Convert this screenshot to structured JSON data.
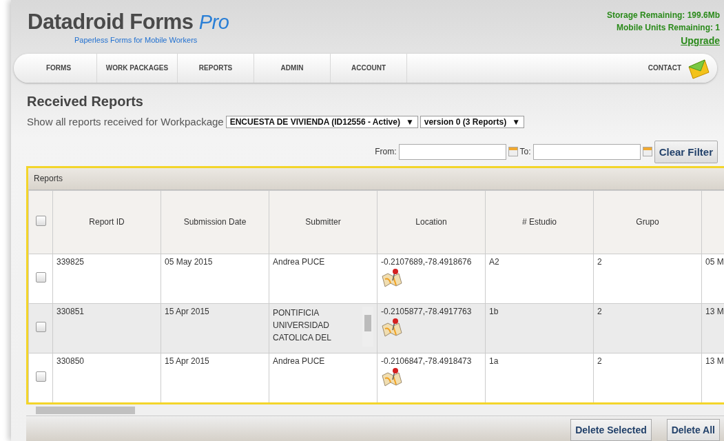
{
  "header": {
    "logo": "Datadroid Forms",
    "logo_suffix": "Pro",
    "tagline": "Paperless Forms for Mobile Workers",
    "storage": "Storage Remaining: 199.6Mb",
    "units": "Mobile Units Remaining: 1",
    "upgrade_link": "Upgrade"
  },
  "nav": {
    "items": [
      "FORMS",
      "WORK PACKAGES",
      "REPORTS",
      "ADMIN",
      "ACCOUNT"
    ],
    "contact": "CONTACT"
  },
  "page": {
    "title": "Received Reports",
    "filter_label": "Show all reports received for Workpackage",
    "workpackage": "ENCUESTA DE VIVIENDA (ID12556 - Active)",
    "workpackage_arrow": "▼",
    "version": "version 0 (3 Reports)",
    "version_arrow": "▼"
  },
  "date_filter": {
    "from_label": "From:",
    "to_label": "To:",
    "clear_button": "Clear Filter"
  },
  "reports": {
    "caption": "Reports",
    "select_all_checked": false,
    "columns": [
      "Report ID",
      "Submission Date",
      "Submitter",
      "Location",
      "# Estudio",
      "Grupo"
    ],
    "rows": [
      {
        "checked": false,
        "selected": false,
        "kind": "plain",
        "cells": [
          "339825",
          "05 May 2015",
          "Andrea PUCE",
          "-0.2107689,-78.4918676",
          "A2",
          "2",
          "05 M"
        ]
      },
      {
        "checked": false,
        "selected": true,
        "kind": "scrolling",
        "cells": [
          "330851",
          "15 Apr 2015",
          "PONTIFICIA UNIVERSIDAD CATOLICA DEL",
          "-0.2105877,-78.4917763",
          "1b",
          "2",
          "13 M"
        ]
      },
      {
        "checked": false,
        "selected": false,
        "kind": "plain",
        "cells": [
          "330850",
          "15 Apr 2015",
          "Andrea PUCE",
          "-0.2106847,-78.4918473",
          "1a",
          "2",
          "13 M"
        ]
      }
    ]
  },
  "footer": {
    "buttons": [
      "Delete Selected",
      "Delete All"
    ]
  }
}
